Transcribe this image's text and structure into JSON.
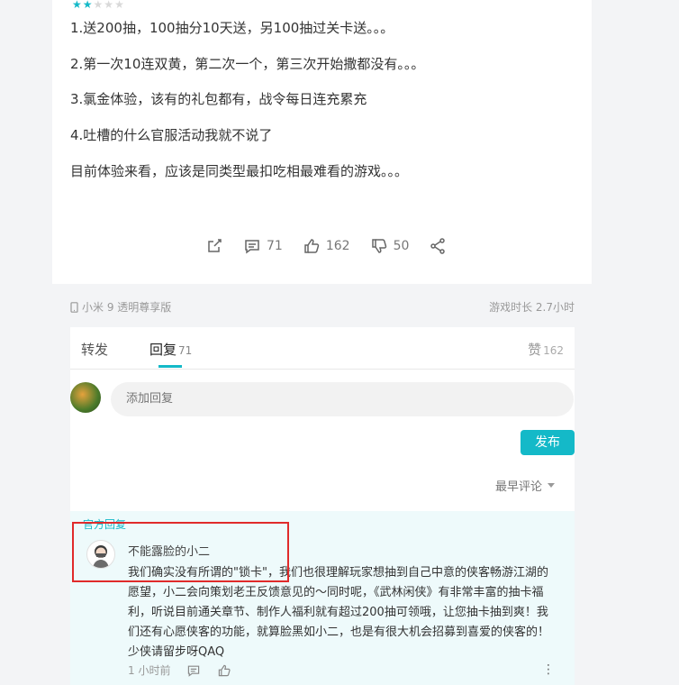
{
  "review": {
    "rating": 2,
    "lines": [
      "1.送200抽，100抽分10天送，另100抽过关卡送。。。",
      "2.第一次10连双黄，第二次一个，第三次开始撒都没有。。。",
      "3.氯金体验，该有的礼包都有，战令每日连充累充",
      "4.吐槽的什么官服活动我就不说了",
      "目前体验来看，应该是同类型最扣吃相最难看的游戏。。。"
    ],
    "actions": {
      "comments": "71",
      "likes": "162",
      "dislikes": "50"
    }
  },
  "meta": {
    "device": "小米 9 透明尊享版",
    "playtime": "游戏时长 2.7小时"
  },
  "tabs": {
    "forward": "转发",
    "reply": "回复",
    "reply_count": "71",
    "like": "赞",
    "like_count": "162"
  },
  "reply_box": {
    "placeholder": "添加回复",
    "publish": "发布"
  },
  "sort": {
    "label": "最早评论"
  },
  "official_reply": {
    "label": "官方回复",
    "name": "不能露脸的小二",
    "text": "我们确实没有所谓的\"锁卡\"，我们也很理解玩家想抽到自己中意的侠客畅游江湖的愿望，小二会向策划老王反馈意见的～同时呢，《武林闲侠》有非常丰富的抽卡福利，听说目前通关章节、制作人福利就有超过200抽可领哦，让您抽卡抽到爽！我们还有心愿侠客的功能，就算脸黑如小二，也是有很大机会招募到喜爱的侠客的！少侠请留步呀QAQ",
    "time": "1 小时前"
  },
  "colors": {
    "accent": "#14b9c8",
    "star_on": "#14b9c8",
    "star_off": "#d9d9d9",
    "highlight": "#e02b2b"
  }
}
